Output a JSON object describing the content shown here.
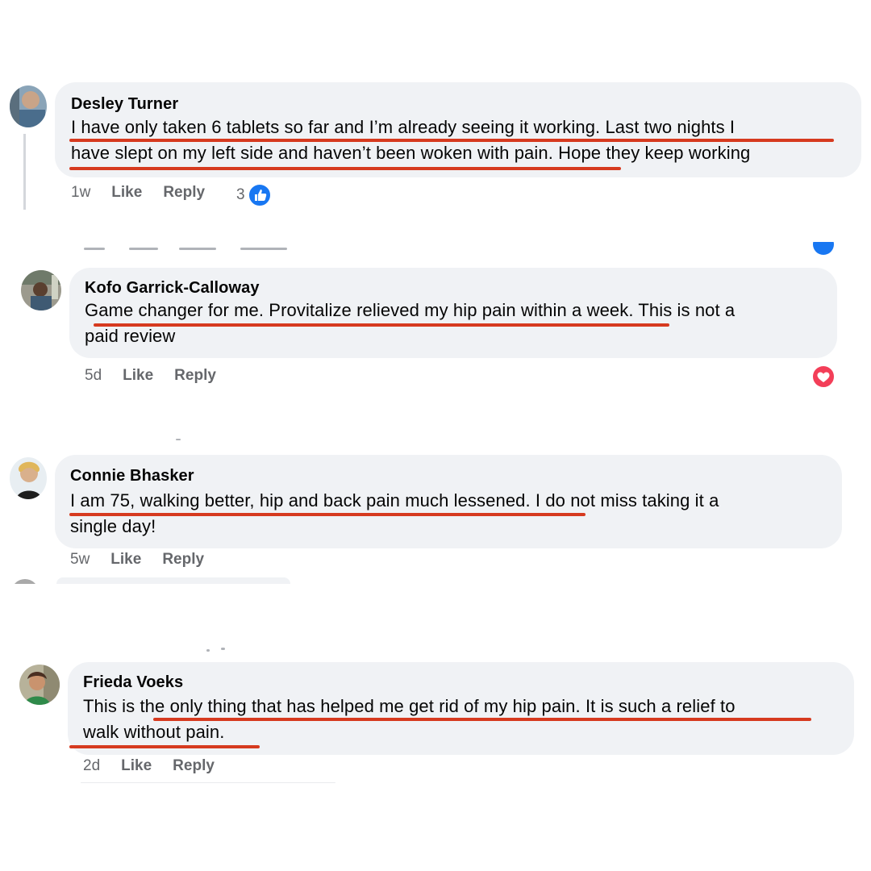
{
  "comments": [
    {
      "author": "Desley Turner",
      "lines": [
        "I have only taken 6 tablets so far and I’m already seeing it working. Last two nights I",
        "have slept on my left side and haven’t been woken with pain. Hope they keep working"
      ],
      "time": "1w",
      "like": "Like",
      "reply": "Reply",
      "reaction_count": "3",
      "reaction_icon": "like-icon"
    },
    {
      "author": "Kofo Garrick-Calloway",
      "lines": [
        "Game changer for me. Provitalize relieved my hip pain within a week. This is not a",
        "paid review"
      ],
      "time": "5d",
      "like": "Like",
      "reply": "Reply",
      "reaction_icon": "love-icon"
    },
    {
      "author": "Connie Bhasker",
      "lines": [
        "I am 75, walking better, hip and back pain much lessened. I do not miss taking it a",
        "single day!"
      ],
      "time": "5w",
      "like": "Like",
      "reply": "Reply"
    },
    {
      "author": "Frieda Voeks",
      "lines": [
        "This is the only thing that has helped me get rid of my hip pain. It is such a relief to",
        "walk without pain."
      ],
      "time": "2d",
      "like": "Like",
      "reply": "Reply"
    }
  ],
  "colors": {
    "bubble": "#f0f2f5",
    "underline": "#d63a1f",
    "meta": "#65676b",
    "like_blue": "#1877f2",
    "love_red": "#f33e58"
  }
}
